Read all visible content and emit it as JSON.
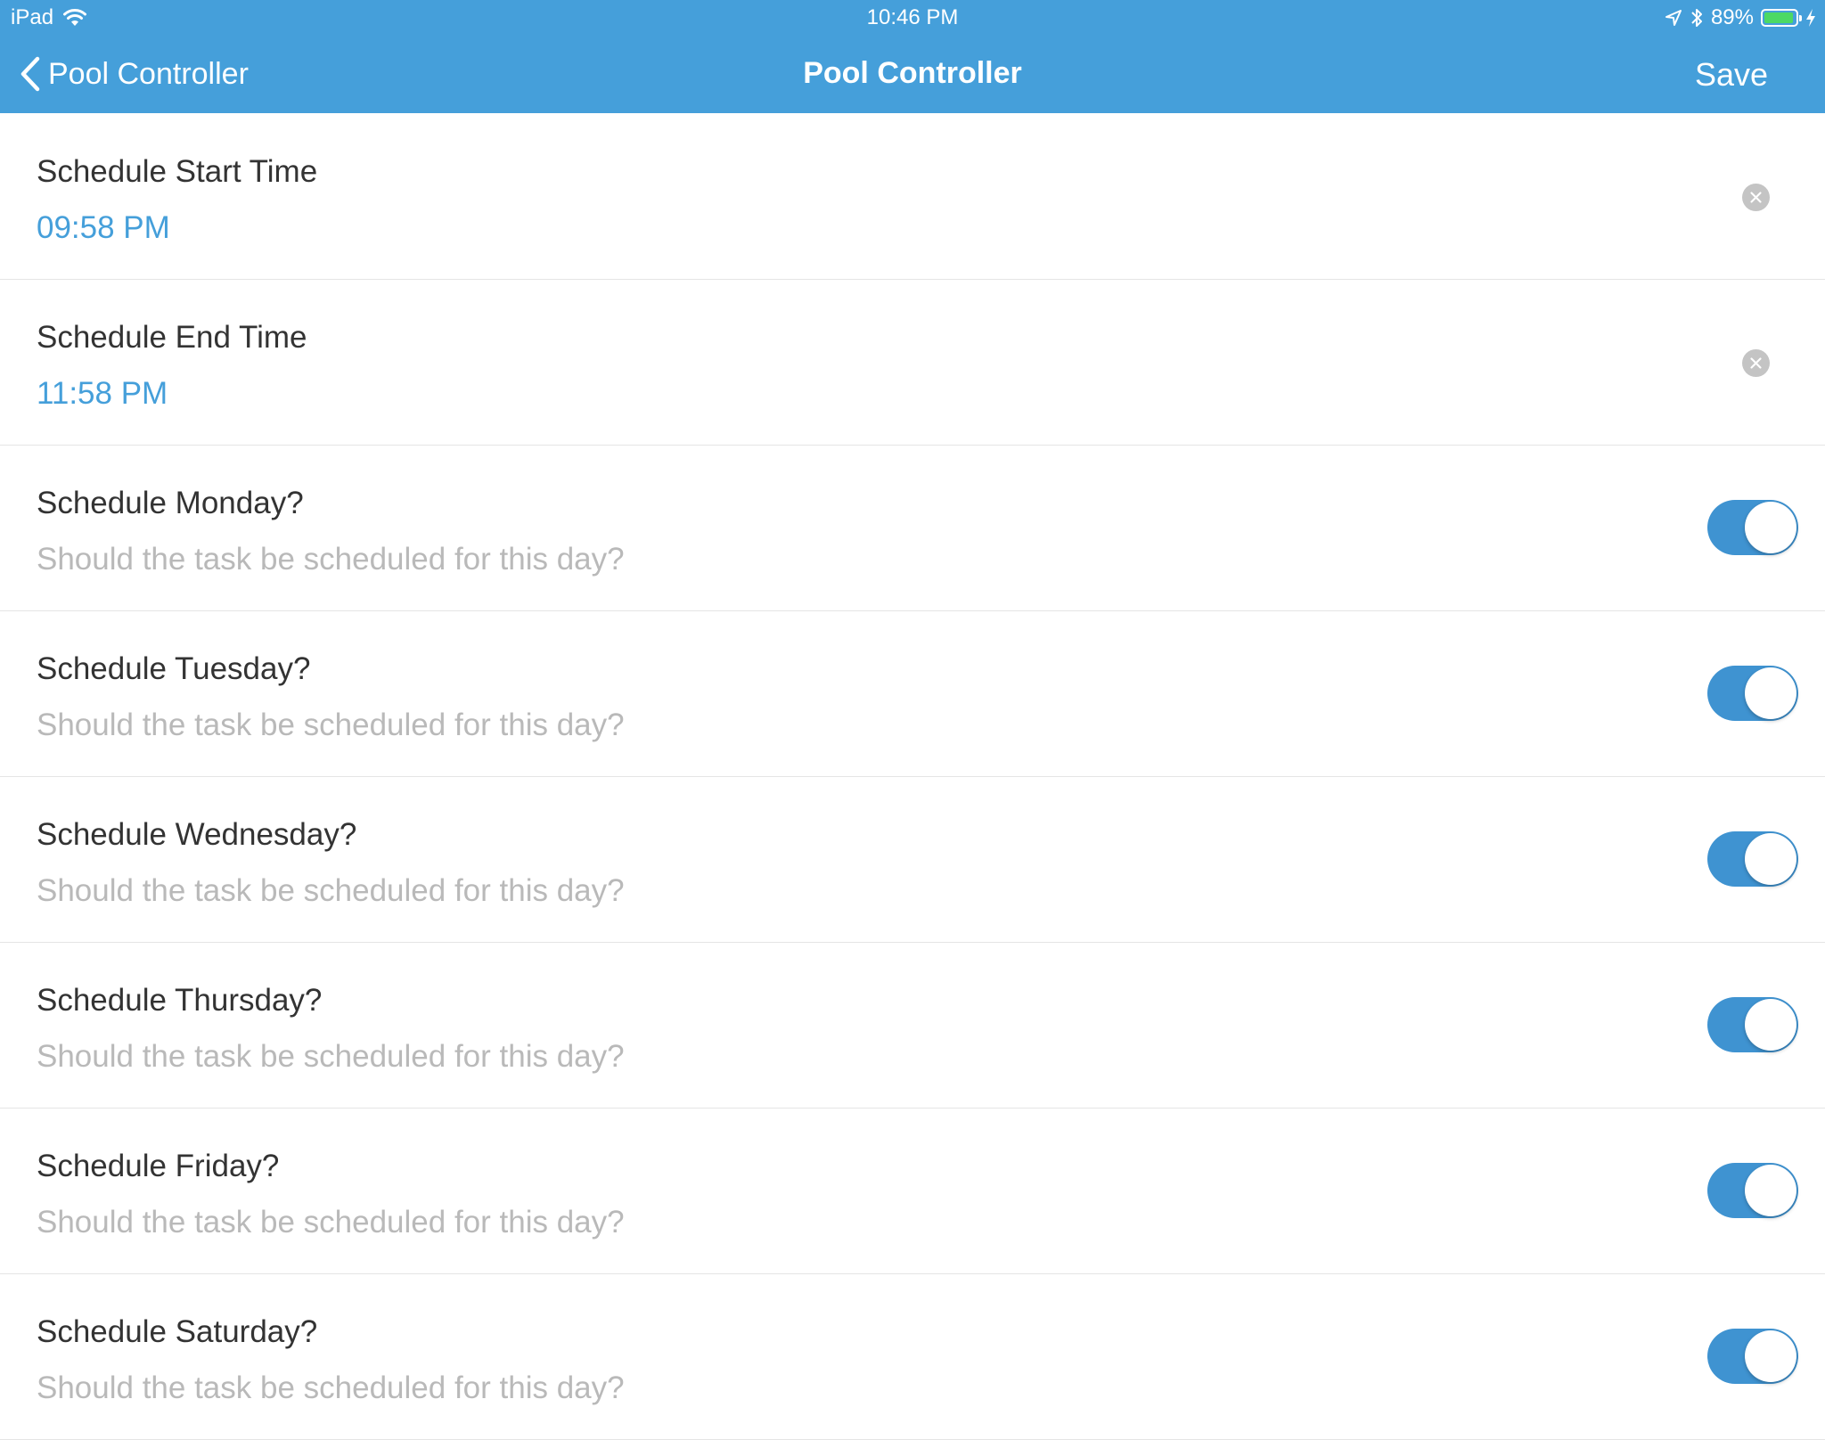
{
  "status_bar": {
    "device": "iPad",
    "time": "10:46 PM",
    "battery_percent": "89%",
    "battery_level": 0.89,
    "icons": [
      "wifi-icon",
      "location-arrow-icon",
      "bluetooth-icon",
      "battery-icon",
      "charging-bolt-icon"
    ]
  },
  "nav": {
    "back_label": "Pool Controller",
    "title": "Pool Controller",
    "save_label": "Save"
  },
  "colors": {
    "bar": "#459fda",
    "accent": "#459fda",
    "toggle_on": "#3f93d1",
    "subtitle": "#b9b9b9",
    "title_text": "#333333"
  },
  "rows": [
    {
      "title": "Schedule Start Time",
      "value": "09:58 PM",
      "type": "time"
    },
    {
      "title": "Schedule End Time",
      "value": "11:58 PM",
      "type": "time"
    },
    {
      "title": "Schedule Monday?",
      "subtitle": "Should the task be scheduled for this day?",
      "type": "toggle",
      "on": true
    },
    {
      "title": "Schedule Tuesday?",
      "subtitle": "Should the task be scheduled for this day?",
      "type": "toggle",
      "on": true
    },
    {
      "title": "Schedule Wednesday?",
      "subtitle": "Should the task be scheduled for this day?",
      "type": "toggle",
      "on": true
    },
    {
      "title": "Schedule Thursday?",
      "subtitle": "Should the task be scheduled for this day?",
      "type": "toggle",
      "on": true
    },
    {
      "title": "Schedule Friday?",
      "subtitle": "Should the task be scheduled for this day?",
      "type": "toggle",
      "on": true
    },
    {
      "title": "Schedule Saturday?",
      "subtitle": "Should the task be scheduled for this day?",
      "type": "toggle",
      "on": true
    }
  ]
}
